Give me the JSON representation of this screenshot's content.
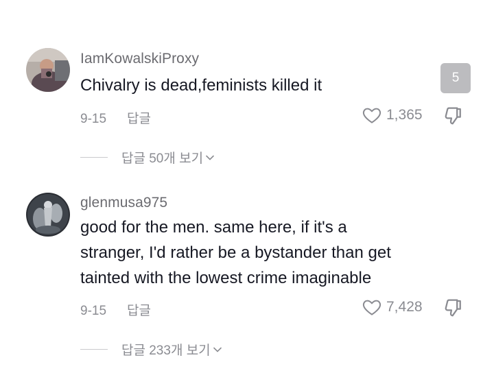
{
  "comments": [
    {
      "username": "IamKowalskiProxy",
      "text_lines": [
        "Chivalry is dead,feminists killed it"
      ],
      "date": "9-15",
      "reply_label": "답글",
      "likes": "1,365",
      "view_replies": "답글 50개 보기"
    },
    {
      "username": "glenmusa975",
      "text_lines": [
        "good for the men. same here, if it's a",
        "stranger, I'd rather be a bystander than get",
        "tainted with the lowest crime imaginable"
      ],
      "date": "9-15",
      "reply_label": "답글",
      "likes": "7,428",
      "view_replies": "답글 233개 보기"
    }
  ],
  "overlay_badge": "5",
  "icons": {
    "like": "heart-outline-icon",
    "dislike": "thumbs-down-outline-icon",
    "expand": "chevron-down-icon"
  },
  "colors": {
    "username": "#6b6b70",
    "meta": "#8a8b91",
    "text": "#161823",
    "badge_bg": "#bcbcbf"
  }
}
